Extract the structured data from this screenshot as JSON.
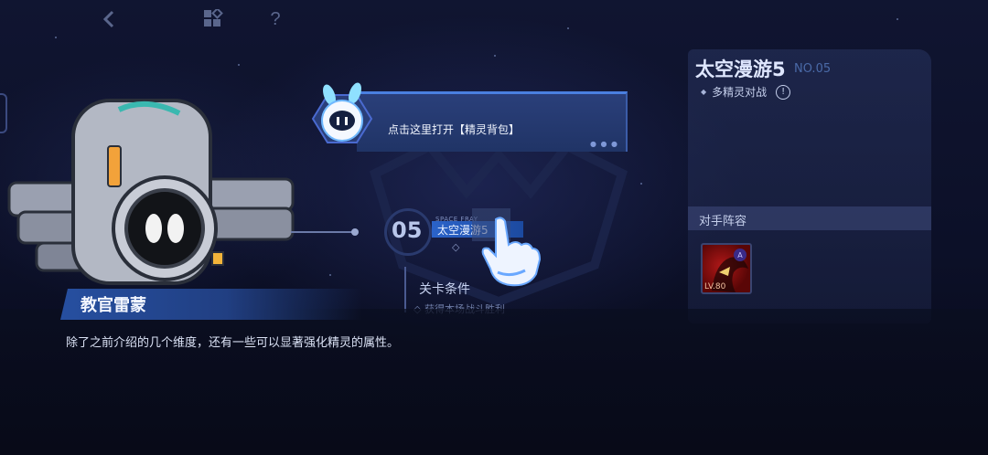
{
  "topbar": {
    "back_icon": "chevron-left-icon",
    "menu_icon": "grid-icon",
    "help_label": "?"
  },
  "stage_panel": {
    "title": "太空漫游5",
    "number": "NO.05",
    "mode": "多精灵对战",
    "info_label": "!",
    "opponent_header": "对手阵容",
    "opponent": {
      "level": "LV.80",
      "rank": "A"
    }
  },
  "stage_node": {
    "number": "05",
    "subtitle": "SPACE FRAY",
    "name": "太空漫游5",
    "condition_title": "关卡条件",
    "condition_desc": "获得本场战斗胜利"
  },
  "tooltip": {
    "text": "点击这里打开【精灵背包】"
  },
  "dialog": {
    "speaker": "教官雷蒙",
    "text": "除了之前介绍的几个维度，还有一些可以显著强化精灵的属性。"
  },
  "colors": {
    "accent": "#2b63c9",
    "panel": "#2a3f7a",
    "background": "#0b0f22"
  }
}
